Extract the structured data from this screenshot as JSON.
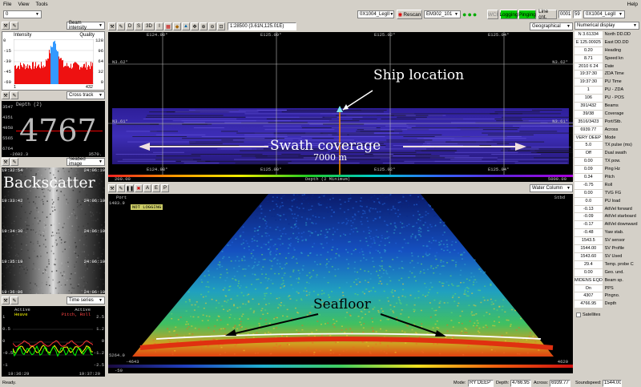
{
  "menu": {
    "file": "File",
    "view": "View",
    "tools": "Tools",
    "help": "Help"
  },
  "toolbar": {
    "left_select": "0",
    "survey1": "0X1004_LegII",
    "rescan": "Rescan",
    "sonar": "EM302_101",
    "wci": "WCI",
    "logging": "Logging",
    "pinging": "Pinging",
    "line_cnt_label": "Line cnt.",
    "line_cnt_value": "0001",
    "line_cnt_num": "59",
    "survey2": "0X1004_LegII"
  },
  "panels": {
    "beam_intensity": {
      "label": "Beam intensity",
      "intensity": "Intensity",
      "quality": "Quality",
      "left_ticks": [
        "0",
        "-15",
        "-30",
        "-45",
        "-60"
      ],
      "right_ticks": [
        "128",
        "96",
        "64",
        "32",
        "0"
      ],
      "x_left": "1",
      "x_right": "432"
    },
    "cross_track": {
      "label": "Cross track",
      "depth_title": "Depth (2)",
      "depth_value": "4767",
      "y_ticks": [
        "3547",
        "4351",
        "4958",
        "5565",
        "6764"
      ],
      "x_left": "-2602.3",
      "x_right": "3570."
    },
    "seabed_image": {
      "label": "Seabed image",
      "times_left": [
        "19:32:54",
        "19:33:42",
        "19:34:30",
        "19:35:19",
        "19:36:06"
      ],
      "times_right": [
        "24:06:10",
        "24:06:10",
        "24:06:10",
        "24:06:10",
        "24:06:10"
      ]
    },
    "time_series": {
      "label": "Time series",
      "active_left": "Active",
      "active_right": "Active",
      "heave": "Heave",
      "pitch_roll": "Pitch, Roll",
      "left_ticks": [
        "1",
        "0.5",
        "0",
        "-0.5",
        "-1"
      ],
      "right_ticks": [
        "2.5",
        "1.2",
        "0",
        "-1.2",
        "-2.5"
      ],
      "t_left": "19:36:29",
      "t_right": "19:37:29"
    }
  },
  "geo": {
    "label": "Geographical",
    "scale": "1:28500 (3.61N,125.01E)",
    "lon_top": [
      "E124.98°",
      "E125.00°",
      "E125.02°",
      "E125.04°"
    ],
    "lon_bottom": [
      "E124.98°",
      "E125.00°",
      "E125.02°",
      "E125.04°"
    ],
    "lat_left": [
      "N3.62°",
      "N3.61°"
    ],
    "lat_right": [
      "N3.62°",
      "N3.61°"
    ],
    "depth_bar_left": "200.00",
    "depth_bar_center": "Depth (2 Minimum)",
    "depth_bar_right": "5000.00"
  },
  "water_column": {
    "label": "Water Column",
    "port": "Port",
    "stbd": "Stbd",
    "not_logging": "NOT LOGGING",
    "y_top": "1483.9",
    "y_bottom": "5264.0",
    "x_left": "-4643",
    "x_right": "4620",
    "scale_left": "-50"
  },
  "annotations": {
    "ship": "Ship location",
    "swath": "Swath coverage",
    "swath_dist": "7000 m",
    "backscatter": "Backscatter",
    "seafloor": "Seafloor"
  },
  "numerical": {
    "label": "Numerical display",
    "rows": [
      {
        "value": "N 3.61334",
        "name": "North DD.DD"
      },
      {
        "value": "E 125.00925",
        "name": "East DD.DD"
      },
      {
        "value": "0.20",
        "name": "Heading"
      },
      {
        "value": "8.71",
        "name": "Speed kn"
      },
      {
        "value": "2010 6 24",
        "name": "Date"
      },
      {
        "value": "19:37:30",
        "name": "ZDA Time"
      },
      {
        "value": "19:37:30",
        "name": "PU Time"
      },
      {
        "value": "1",
        "name": "PU - ZDA"
      },
      {
        "value": "106",
        "name": "PU - POS"
      },
      {
        "value": "391/432",
        "name": "Beams"
      },
      {
        "value": "39/38",
        "name": "Coverage"
      },
      {
        "value": "3516/3423",
        "name": "Port/Stb."
      },
      {
        "value": "6939.77",
        "name": "Across"
      },
      {
        "value": "VERY DEEP",
        "name": "Mode"
      },
      {
        "value": "5.0",
        "name": "TX pulse (ms)"
      },
      {
        "value": "Off",
        "name": "Dual swath"
      },
      {
        "value": "0.00",
        "name": "TX pow."
      },
      {
        "value": "0.09",
        "name": "Ping Hz"
      },
      {
        "value": "0.34",
        "name": "Pitch"
      },
      {
        "value": "-0.75",
        "name": "Roll"
      },
      {
        "value": "0.00",
        "name": "TVG FG"
      },
      {
        "value": "0.0",
        "name": "PU load"
      },
      {
        "value": "-0.13",
        "name": "AttVel forward"
      },
      {
        "value": "-0.09",
        "name": "AttVel starboard"
      },
      {
        "value": "-0.17",
        "name": "AttVel downward"
      },
      {
        "value": "-0.48",
        "name": "Yaw stab."
      },
      {
        "value": "1543.5",
        "name": "SV sensor"
      },
      {
        "value": "1544.00",
        "name": "SV Profile"
      },
      {
        "value": "1543.60",
        "name": "SV Used"
      },
      {
        "value": "29.4",
        "name": "Temp. probe C"
      },
      {
        "value": "0.00",
        "name": "Geo. und."
      },
      {
        "value": "MIDENS EQDIST",
        "name": "Beam sp."
      },
      {
        "value": "On",
        "name": "PPS"
      },
      {
        "value": "4307",
        "name": "Pingno."
      },
      {
        "value": "4766.95",
        "name": "Depth"
      }
    ],
    "satellites": "Satellites"
  },
  "status": {
    "ready": "Ready.",
    "mode_label": "Mode:",
    "mode_value": "RY DEEP",
    "depth_label": "Depth:",
    "depth_value": "4766.95",
    "across_label": "Across:",
    "across_value": "6939.77",
    "sound_label": "Soundspeed:",
    "sound_value": "1544.00"
  },
  "colors": {
    "logging": "#00c800",
    "pinging": "#00c800",
    "ship_track": "#ff8c00"
  }
}
